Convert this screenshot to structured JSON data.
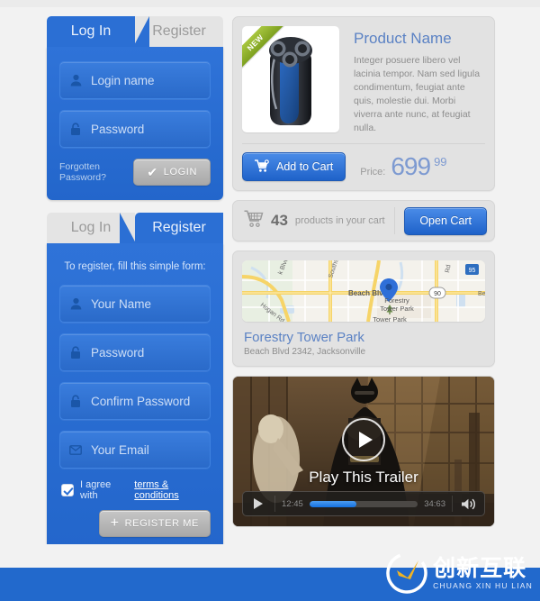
{
  "login_panel": {
    "tabs": [
      {
        "label": "Log In",
        "active": true
      },
      {
        "label": "Register",
        "active": false
      }
    ],
    "fields": [
      {
        "icon": "user-icon",
        "placeholder": "Login name"
      },
      {
        "icon": "lock-icon",
        "placeholder": "Password"
      }
    ],
    "forgot_label": "Forgotten Password?",
    "submit_label": "LOGIN"
  },
  "register_panel": {
    "tabs": [
      {
        "label": "Log In",
        "active": false
      },
      {
        "label": "Register",
        "active": true
      }
    ],
    "hint": "To register, fill this simple form:",
    "fields": [
      {
        "icon": "user-icon",
        "placeholder": "Your Name"
      },
      {
        "icon": "lock-icon",
        "placeholder": "Password"
      },
      {
        "icon": "lock-icon",
        "placeholder": "Confirm Password"
      },
      {
        "icon": "envelope-icon",
        "placeholder": "Your Email"
      }
    ],
    "terms_text": "I agree with",
    "terms_link": "terms & conditions",
    "terms_checked": true,
    "submit_label": "REGISTER ME"
  },
  "product": {
    "badge": "NEW",
    "title": "Product Name",
    "description": "Integer posuere libero vel lacinia tempor. Nam sed ligula condimentum, feugiat ante quis, molestie dui. Morbi viverra ante nunc, at feugiat nulla.",
    "add_to_cart_label": "Add to Cart",
    "price_label": "Price:",
    "price_main": "699",
    "price_cents": "99"
  },
  "cart": {
    "count": "43",
    "text": "products in your cart",
    "open_label": "Open Cart"
  },
  "map": {
    "title": "Forestry Tower Park",
    "address": "Beach Blvd 2342, Jacksonville",
    "marker_label_line1": "Forestry",
    "marker_label_line2": "Tower Park",
    "streets": {
      "beach_blvd": "Beach Blvd",
      "southside": "Southside",
      "k_blvd": "k Blvd",
      "hogan_rd": "Hogan Rd",
      "rd": "Rd",
      "shield_90": "90",
      "shield_95": "95",
      "right_edge": "Be"
    }
  },
  "video": {
    "play_label": "Play This Trailer",
    "current_time": "12:45",
    "total_time": "34:63",
    "progress_percent": 43
  },
  "footer": {
    "logo_cn": "创新互联",
    "logo_en": "CHUANG XIN HU LIAN"
  },
  "colors": {
    "accent_blue": "#2b6fd4",
    "panel_blue": "#2366cb",
    "card_grey": "#e2e2e2",
    "page_bg": "#f2f2f2",
    "title_blue": "#5b82c4",
    "ribbon_green": "#7da01f",
    "footer_blue": "#2269cc"
  }
}
